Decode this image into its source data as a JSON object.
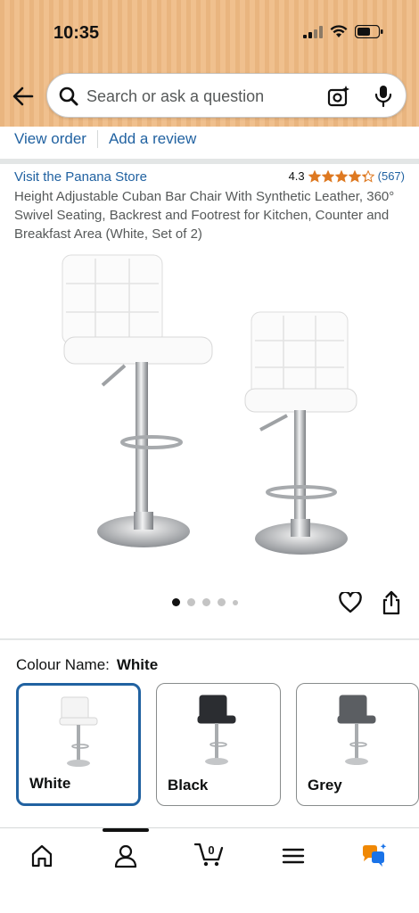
{
  "status_bar": {
    "time": "10:35"
  },
  "search": {
    "placeholder": "Search or ask a question"
  },
  "links": {
    "view_order": "View order",
    "add_review": "Add a review"
  },
  "product": {
    "store": "Visit the Panana Store",
    "rating": "4.3",
    "rating_stars": 4.3,
    "review_count": "(567)",
    "title": "Height Adjustable Cuban Bar Chair With Synthetic Leather, 360° Swivel Seating, Backrest and Footrest for Kitchen, Counter and Breakfast Area (White, Set of 2)",
    "image_count": 5,
    "current_image": 1
  },
  "colour": {
    "label": "Colour Name:",
    "selected": "White",
    "options": [
      {
        "name": "White",
        "color": "#f4f4f4",
        "selected": true
      },
      {
        "name": "Black",
        "color": "#2b2d31",
        "selected": false
      },
      {
        "name": "Grey",
        "color": "#5b5e62",
        "selected": false
      }
    ]
  },
  "bottom_nav": {
    "items": [
      "home-icon",
      "account-icon",
      "cart-icon",
      "menu-icon",
      "rufus-icon"
    ],
    "cart_count": "0",
    "active": "account-icon"
  },
  "colors": {
    "link": "#2162a1",
    "star": "#de7921",
    "header": "#f0c08e"
  }
}
